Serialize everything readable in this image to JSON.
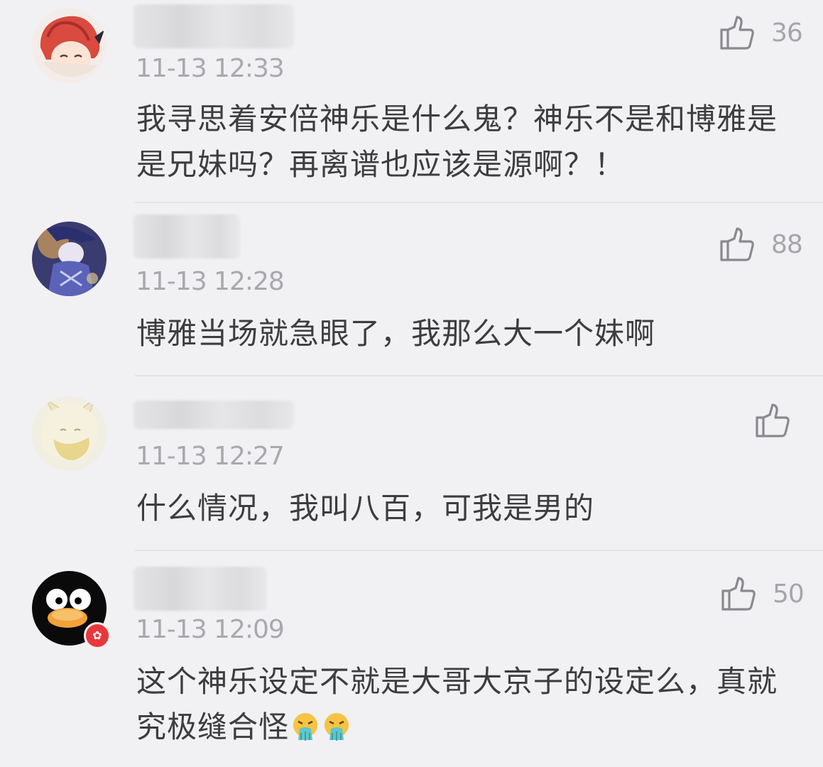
{
  "comments": [
    {
      "time": "11-13 12:33",
      "text": "我寻思着安倍神乐是什么鬼？神乐不是和博雅是是兄妹吗？再离谱也应该是源啊？！",
      "likes": "36",
      "avatar": "red-haired-anime-avatar"
    },
    {
      "time": "11-13 12:28",
      "text": "博雅当场就急眼了，我那么大一个妹啊",
      "likes": "88",
      "avatar": "blue-anime-character-avatar"
    },
    {
      "time": "11-13 12:27",
      "text": "什么情况，我叫八百，可我是男的",
      "likes": "",
      "avatar": "white-fox-anime-avatar"
    },
    {
      "time": "11-13 12:09",
      "text": "这个神乐设定不就是大哥大京子的设定么，真就究极缝合怪",
      "likes": "50",
      "avatar": "black-penguin-avatar",
      "emojis": [
        "vomit-emoji",
        "vomit-emoji"
      ]
    }
  ],
  "colors": {
    "background": "#f1f0f3",
    "text": "#3d3d3f",
    "meta": "#a9a8ad",
    "badge": "#e8383b"
  },
  "icons": {
    "like": "thumbs-up-icon",
    "badge": "star-badge-icon"
  }
}
